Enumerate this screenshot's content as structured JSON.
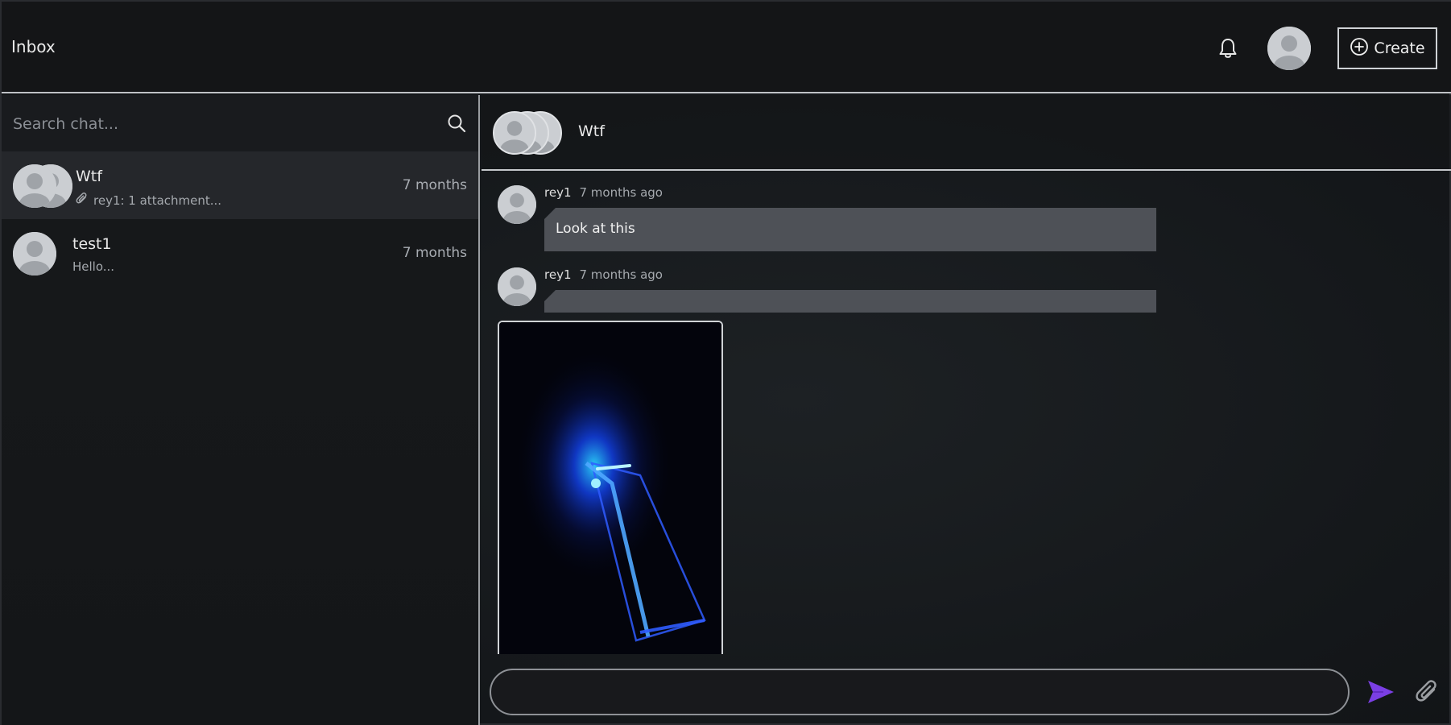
{
  "header": {
    "title": "Inbox",
    "create_label": "Create",
    "icons": {
      "notifications": "bell-icon",
      "profile": "avatar",
      "create": "plus-circle-icon"
    }
  },
  "sidebar": {
    "search_placeholder": "Search chat...",
    "chats": [
      {
        "name": "Wtf",
        "preview": "rey1: 1 attachment...",
        "preview_icon": "paperclip-icon",
        "time": "7 months",
        "active": true
      },
      {
        "name": "test1",
        "preview": "Hello...",
        "time": "7 months",
        "active": false
      }
    ]
  },
  "conversation": {
    "title": "Wtf",
    "messages": [
      {
        "author": "rey1",
        "when": "7 months ago",
        "text": "Look at this"
      },
      {
        "author": "rey1",
        "when": "7 months ago",
        "text": ""
      }
    ],
    "composer_value": "",
    "icons": {
      "send": "send-icon",
      "attach": "paperclip-icon"
    }
  },
  "colors": {
    "background": "#111316",
    "bubble": "#4e5157",
    "send_accent": "#7b3fe4",
    "divider": "#c4c7cb"
  }
}
